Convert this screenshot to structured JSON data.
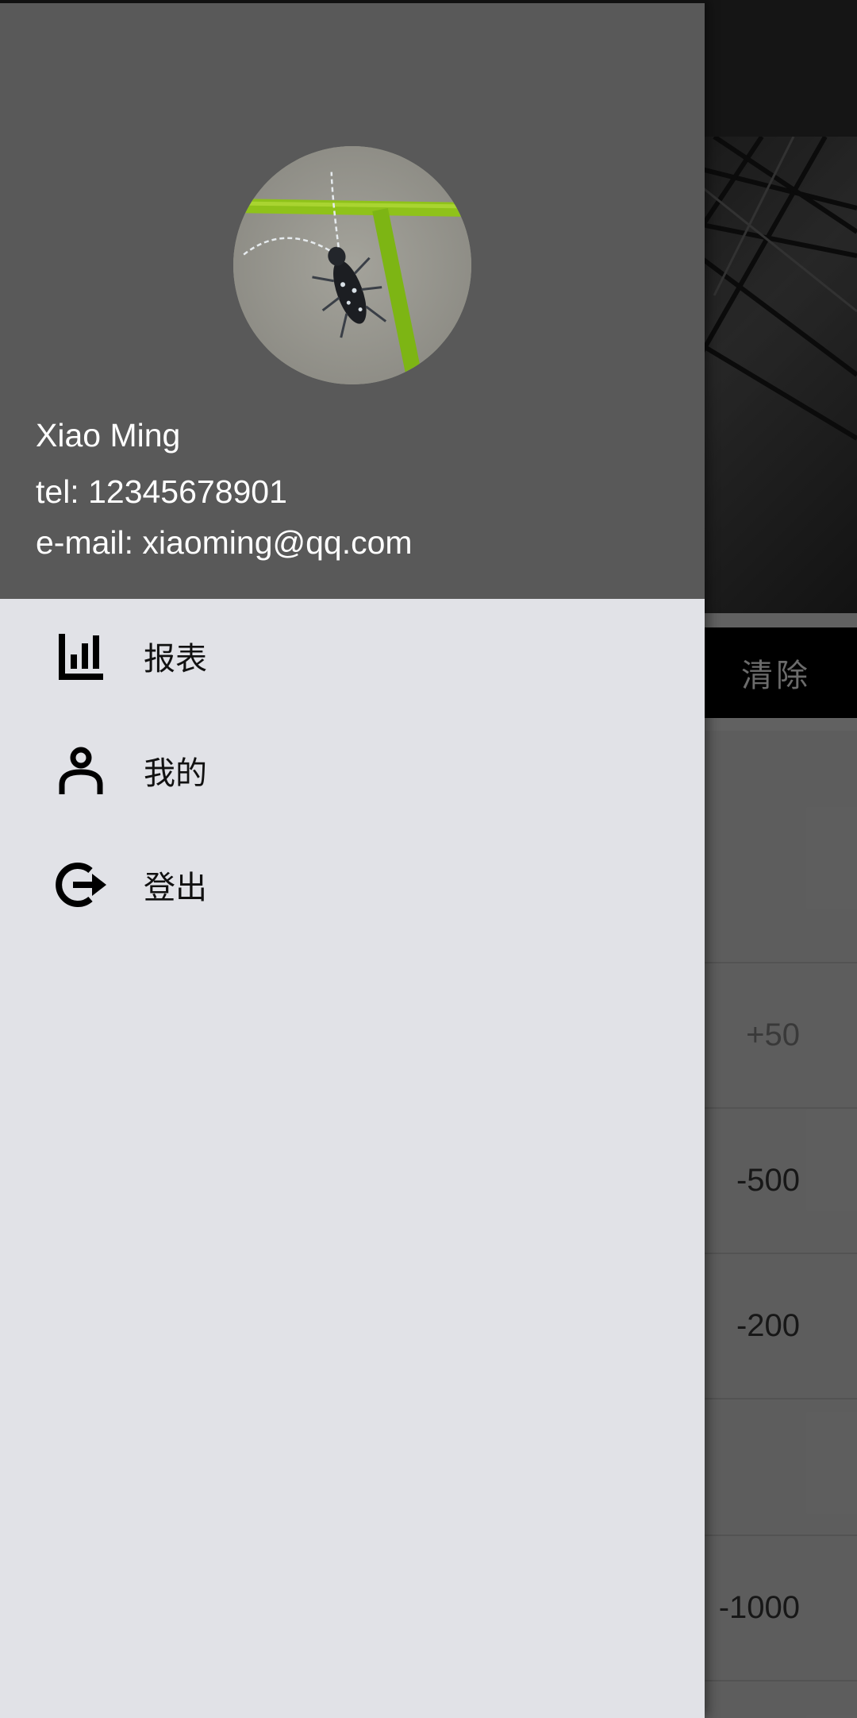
{
  "background_app": {
    "clear_button_label": "清除",
    "records": [
      "",
      "+50",
      "-500",
      "-200",
      "",
      "-1000"
    ]
  },
  "drawer": {
    "header": {
      "name": "Xiao Ming",
      "tel": "tel: 12345678901",
      "email": "e-mail: xiaoming@qq.com"
    },
    "menu": [
      {
        "icon": "bar-chart-icon",
        "label": "报表"
      },
      {
        "icon": "person-icon",
        "label": "我的"
      },
      {
        "icon": "logout-icon",
        "label": "登出"
      }
    ]
  },
  "colors": {
    "drawer_header": "#595959",
    "drawer_body": "#e1e2e7",
    "scrim": "rgba(0,0,0,0.32)"
  }
}
